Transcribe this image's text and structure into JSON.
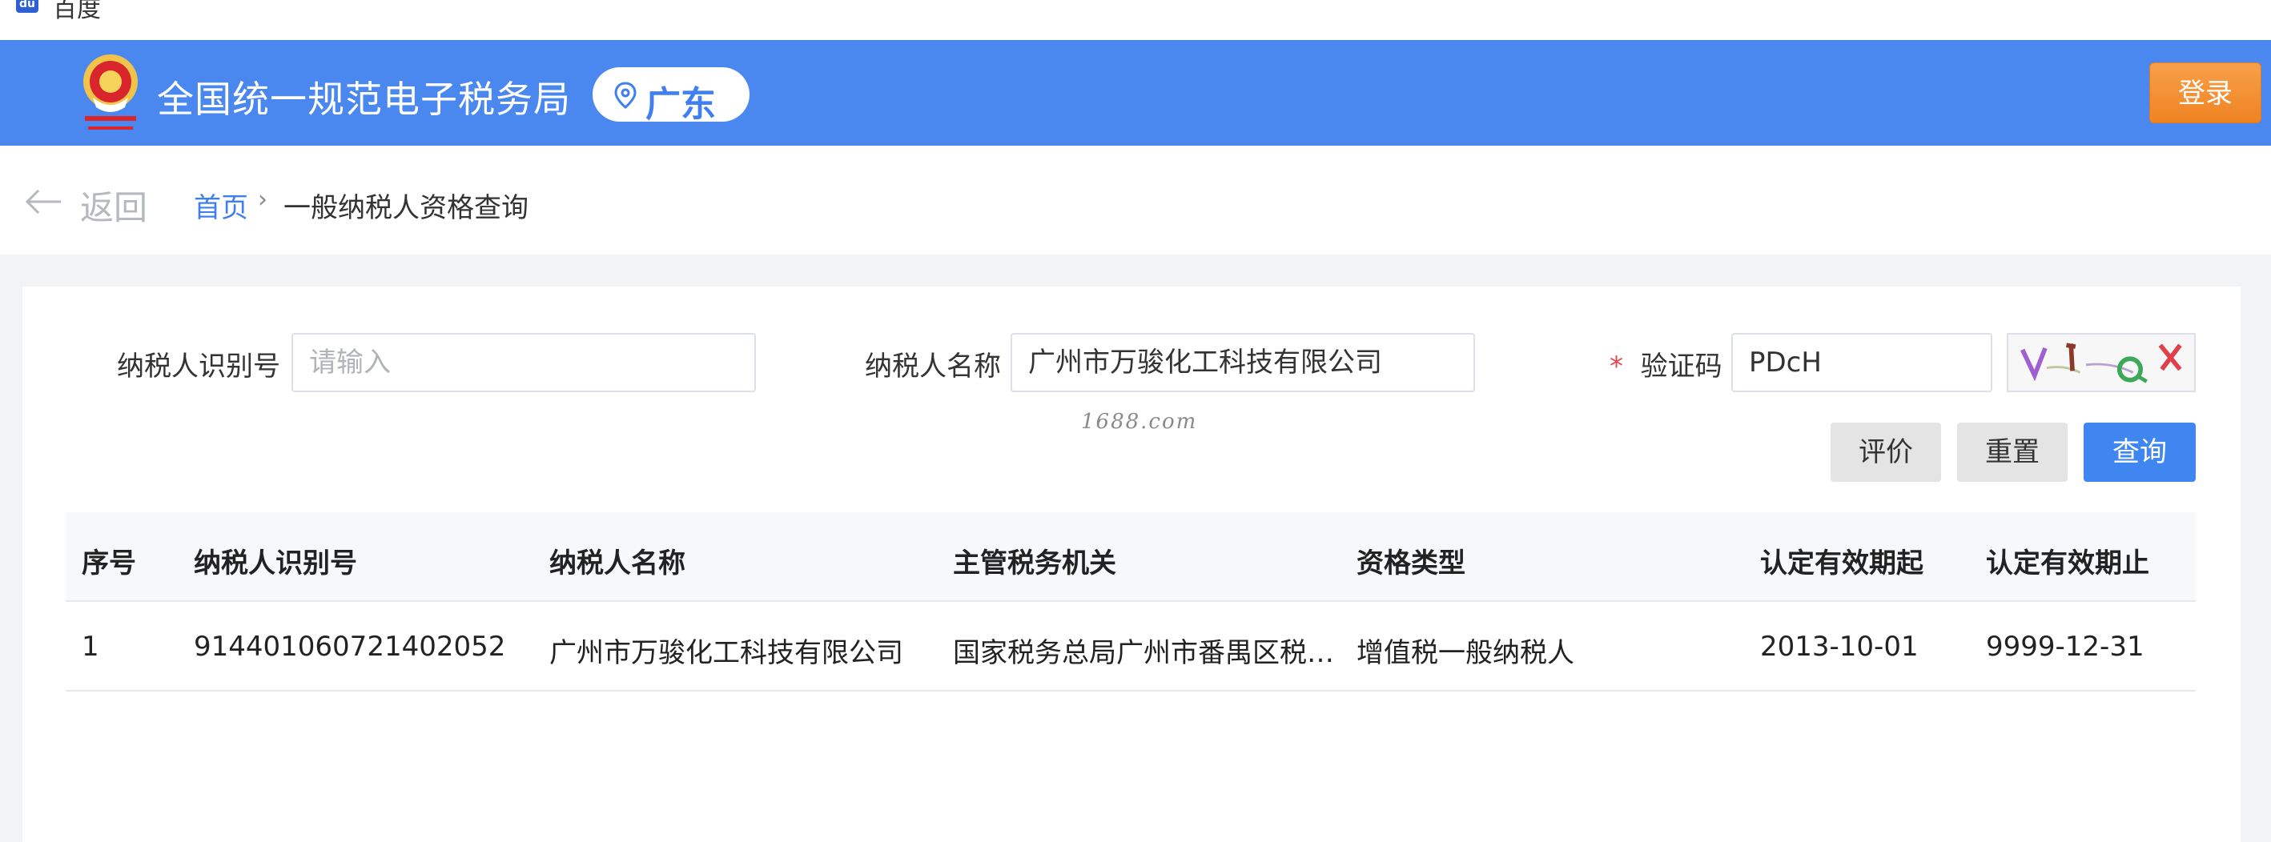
{
  "browser": {
    "tab_title": "百度"
  },
  "header": {
    "site_title": "全国统一规范电子税务局",
    "region": "广东",
    "login_label": "登录"
  },
  "breadcrumb": {
    "back_label": "返回",
    "home_label": "首页",
    "separator": "›",
    "current_label": "一般纳税人资格查询"
  },
  "form": {
    "taxpayer_id": {
      "label": "纳税人识别号",
      "value": "",
      "placeholder": "请输入"
    },
    "taxpayer_name": {
      "label": "纳税人名称",
      "value": "广州市万骏化工科技有限公司"
    },
    "captcha": {
      "required_mark": "*",
      "label": "验证码",
      "value": "PDcH"
    },
    "watermark": "1688.com",
    "buttons": {
      "evaluate": "评价",
      "reset": "重置",
      "query": "查询"
    }
  },
  "table": {
    "columns": [
      "序号",
      "纳税人识别号",
      "纳税人名称",
      "主管税务机关",
      "资格类型",
      "认定有效期起",
      "认定有效期止"
    ],
    "rows": [
      [
        "1",
        "914401060721402052",
        "广州市万骏化工科技有限公司",
        "国家税务总局广州市番禺区税…",
        "增值税一般纳税人",
        "2013-10-01",
        "9999-12-31"
      ]
    ]
  },
  "colors": {
    "header_blue": "#4a88f0",
    "login_orange": "#ef8322",
    "link_blue": "#3f7ff0",
    "query_blue": "#3f86f0"
  }
}
